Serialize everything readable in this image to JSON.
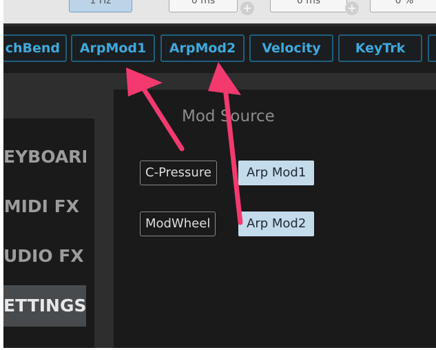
{
  "top_params": [
    {
      "value": "1 Hz",
      "active": true
    },
    {
      "value": "0 ms",
      "active": false
    },
    {
      "value": "0 ms",
      "active": false
    },
    {
      "value": "0 %",
      "active": false
    }
  ],
  "mod_tabs": [
    {
      "label": "chBend"
    },
    {
      "label": "ArpMod1"
    },
    {
      "label": "ArpMod2"
    },
    {
      "label": "Velocity"
    },
    {
      "label": "KeyTrk"
    }
  ],
  "sidebar": {
    "items": [
      {
        "label": "EYBOARD",
        "selected": false
      },
      {
        "label": "MIDI FX",
        "selected": false
      },
      {
        "label": "UDIO FX",
        "selected": false
      },
      {
        "label": "ETTINGS",
        "selected": true
      }
    ]
  },
  "panel": {
    "title": "Mod Source",
    "rows": [
      {
        "source": "C-Pressure",
        "target": "Arp Mod1"
      },
      {
        "source": "ModWheel",
        "target": "Arp Mod2"
      }
    ]
  },
  "colors": {
    "accent_blue": "#3fa9dc",
    "annotation_arrow": "#f23a6f",
    "target_box": "#c4dbec"
  }
}
